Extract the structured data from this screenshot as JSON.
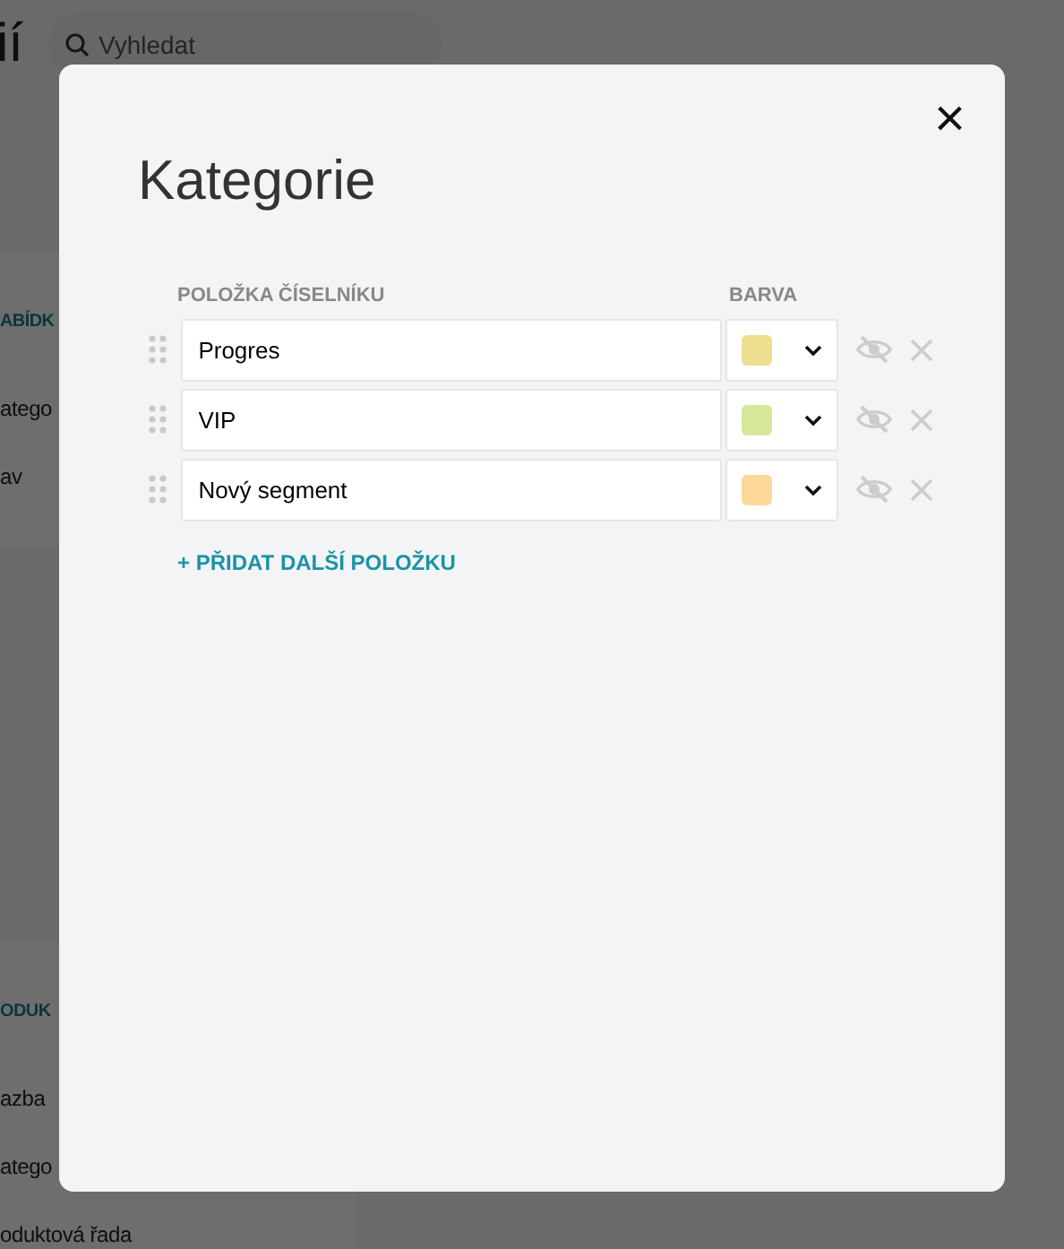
{
  "page": {
    "title": "ií",
    "search": {
      "placeholder": "Vyhledat"
    },
    "sections": [
      {
        "heading": "ABÍDK",
        "items": [
          "atego",
          "av"
        ]
      },
      {
        "heading": "ODUK",
        "items": [
          "azba",
          "atego",
          "oduktová řada"
        ]
      }
    ]
  },
  "modal": {
    "title": "Kategorie",
    "close": "×",
    "columns": [
      "POLOŽKA ČÍSELNÍKU",
      "BARVA"
    ],
    "items": [
      {
        "value": "Progres",
        "color": "#eddf8e"
      },
      {
        "value": "VIP",
        "color": "#d6e899"
      },
      {
        "value": "Nový segment",
        "color": "#fcd998"
      }
    ],
    "add_button": "+ PŘIDAT DALŠÍ POLOŽKU"
  }
}
